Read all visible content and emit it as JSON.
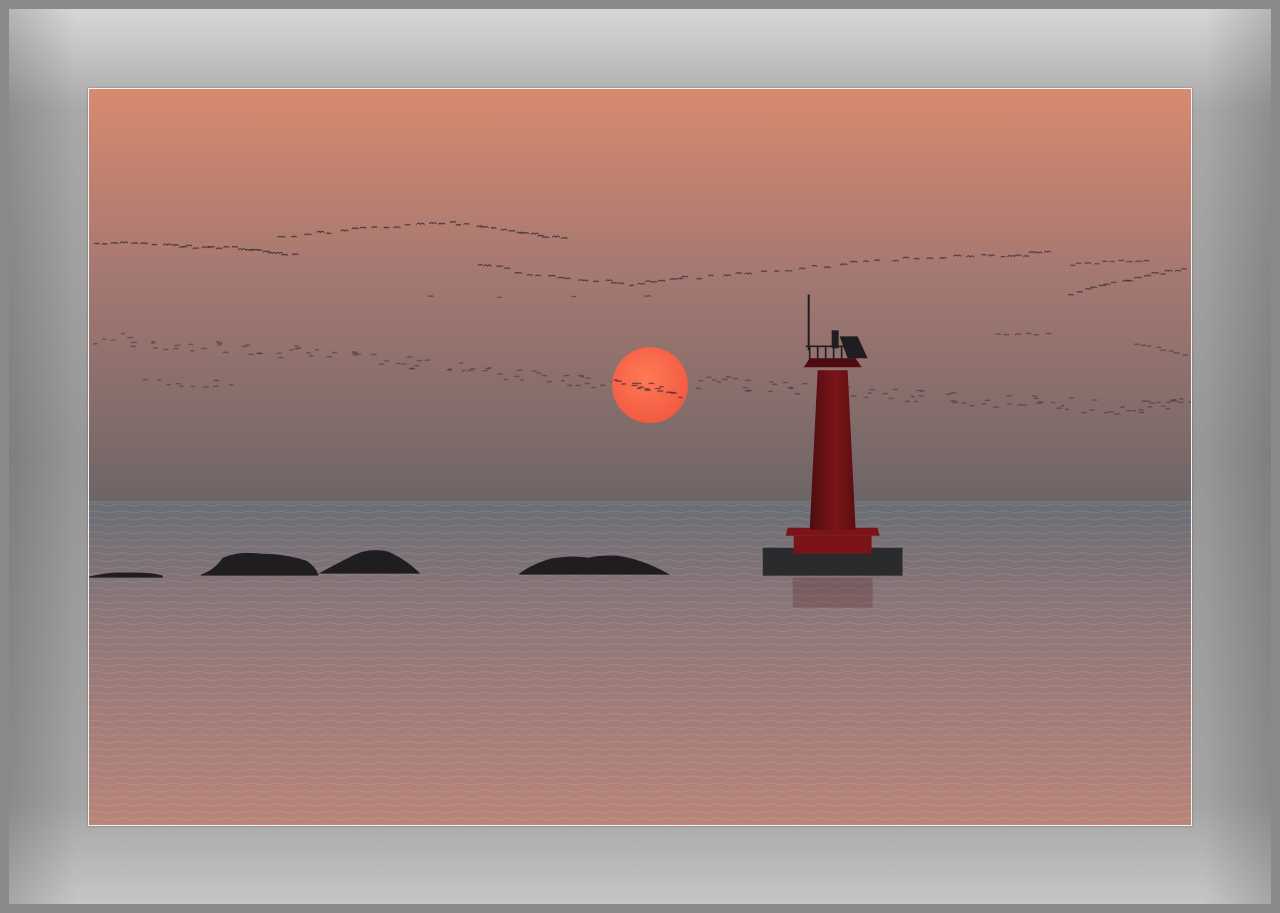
{
  "photo": {
    "colors": {
      "sky_top": "#d88a6e",
      "sky_mid": "#a57872",
      "sky_low": "#6e6566",
      "sea_top": "#6b6d75",
      "sea_mid": "#8d7678",
      "sea_bottom": "#b98479",
      "sun_center": "#ff7a55",
      "sun_edge": "#f25a41",
      "lighthouse": "#7b1418",
      "lighthouse_shadow": "#4e0c10",
      "rocks": "#1f1d20",
      "birds": "#3a2e33",
      "mat": "#9b9b9b"
    }
  }
}
